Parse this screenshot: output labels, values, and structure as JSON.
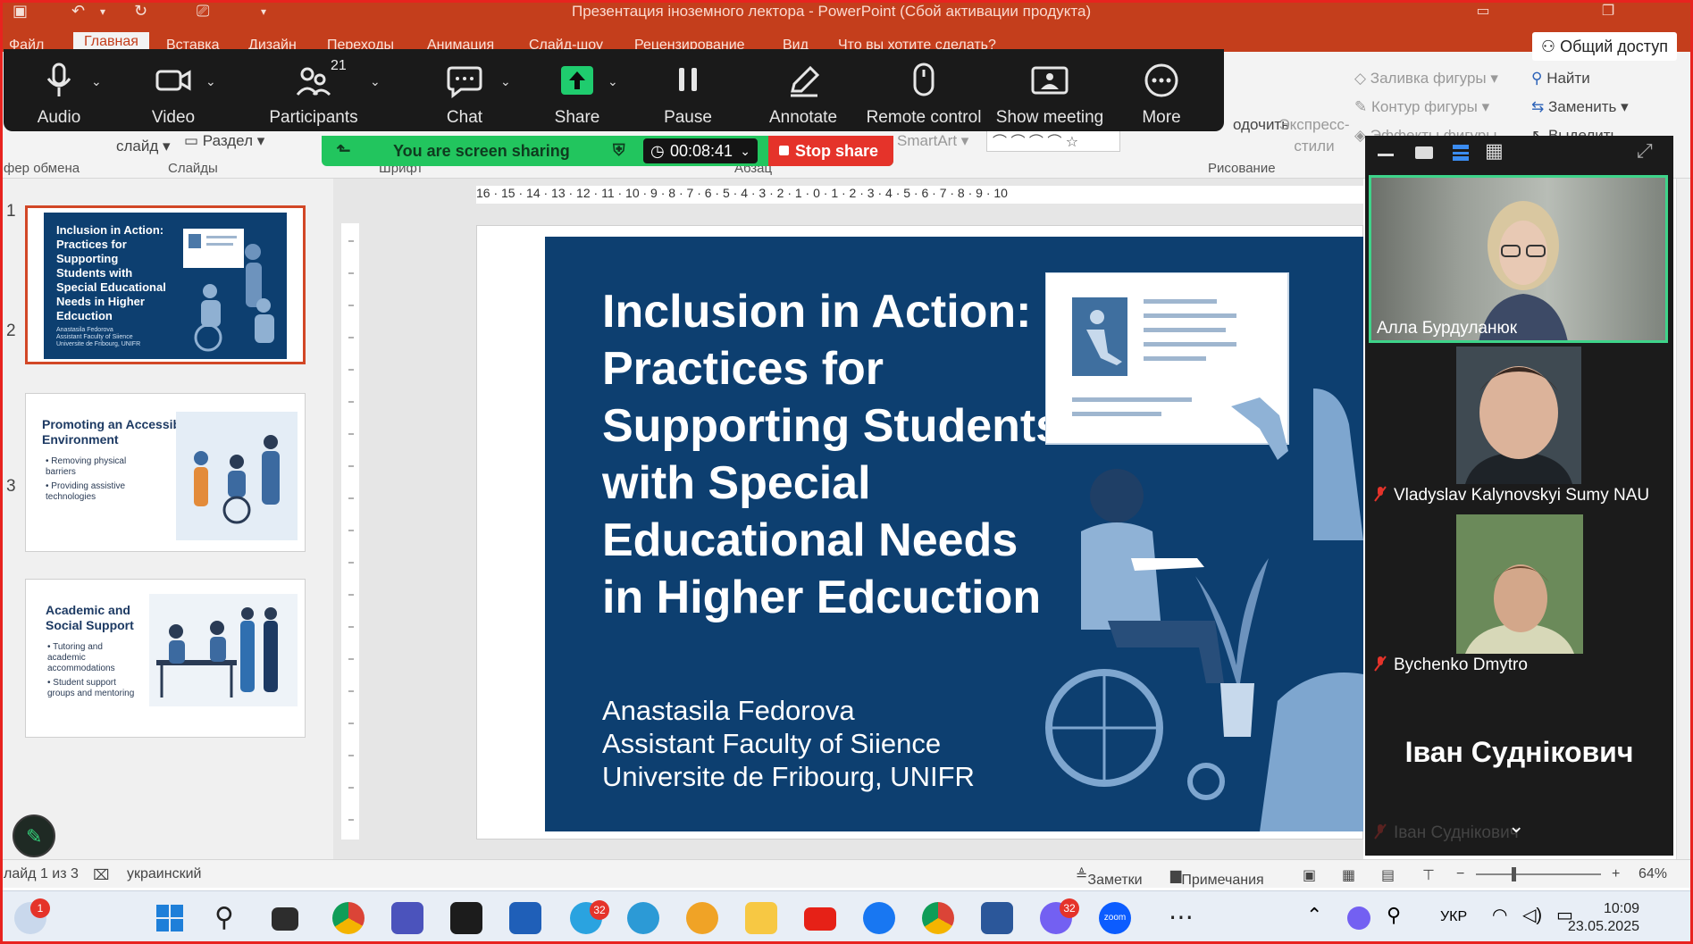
{
  "window": {
    "title": "Презентация іноземного лектора - PowerPoint (Сбой активации продукта)"
  },
  "ribbon": {
    "tabs": [
      "Файл",
      "Главная",
      "Вставка",
      "Дизайн",
      "Переходы",
      "Анимация",
      "Слайд-шоу",
      "Рецензирование",
      "Вид"
    ],
    "search_placeholder": "Что вы хотите сделать?",
    "share_access": "Общий доступ",
    "slide_btn": "слайд",
    "section_btn": "Раздел",
    "smartart": "SmartArt",
    "fill_shape": "Заливка фигуры",
    "outline_shape": "Контур фигуры",
    "effects_shape": "Эффекты фигуры",
    "arrange": "одочить",
    "quick_styles": "Экспресс-стили",
    "find": "Найти",
    "replace": "Заменить",
    "select": "Выделить",
    "groups": {
      "clipboard": "фер обмена",
      "slides": "Слайды",
      "font": "Шрифт",
      "paragraph": "Абзац",
      "drawing": "Рисование"
    }
  },
  "zoom_toolbar": {
    "audio": "Audio",
    "video": "Video",
    "participants": "Participants",
    "participants_count": "21",
    "chat": "Chat",
    "share": "Share",
    "pause": "Pause",
    "annotate": "Annotate",
    "remote_control": "Remote control",
    "show_meeting": "Show meeting",
    "more": "More"
  },
  "share_banner": {
    "status": "You are screen sharing",
    "timer": "00:08:41",
    "stop": "Stop share"
  },
  "slides": [
    {
      "num": "1",
      "title": "Inclusion in Action: Practices for Supporting Students with Special Educational Needs in Higher Edcuction",
      "author_lines": [
        "Anastasila Fedorova",
        "Assistant Faculty of Siience",
        "Universite de Fribourg, UNIFR"
      ]
    },
    {
      "num": "2",
      "title": "Promoting an Accessible Environment",
      "bullets": [
        "Removing physical barriers",
        "Providing assistive technologies"
      ]
    },
    {
      "num": "3",
      "title": "Academic and Social Support",
      "bullets": [
        "Tutoring and academic accommodations",
        "Student support groups and mentoring"
      ]
    }
  ],
  "main_slide": {
    "title": "Inclusion in Action: Practices for Supporting Students with Special Educational Needs in Higher Edcuction",
    "author": "Anastasila Fedorova",
    "faculty": "Assistant Faculty of Siience",
    "university": "Universite de Fribourg, UNIFR"
  },
  "ruler": {
    "h": "16 · 15 · 14 · 13 · 12 · 11 · 10 · 9 · 8 · 7 · 6 · 5 · 4 · 3 · 2 · 1 · 0 · 1 · 2 · 3 · 4 · 5 · 6 · 7 · 8 · 9 · 10"
  },
  "participants": [
    {
      "name": "Алла Бурдуланюк",
      "muted": false
    },
    {
      "name": "Vladyslav Kalynovskyi Sumy NAU",
      "muted": true
    },
    {
      "name": "Bychenko Dmytro",
      "muted": true
    },
    {
      "name": "Іван Суднікович",
      "muted": true
    }
  ],
  "statusbar": {
    "slide_info": "лайд 1 из 3",
    "language": "украинский",
    "notes": "Заметки",
    "comments": "Примечания",
    "zoom_level": "64%"
  },
  "taskbar": {
    "weather_badge": "1",
    "telegram_badge": "32",
    "viber_badge": "32",
    "zoom_label": "zoom",
    "language": "УКР",
    "time": "10:09",
    "date": "23.05.2025"
  },
  "colors": {
    "ppt_accent": "#c43e1c",
    "share_green": "#22c55e",
    "stop_red": "#e5332a",
    "slide_blue": "#0d3f70",
    "active_speaker": "#3ed48a"
  }
}
